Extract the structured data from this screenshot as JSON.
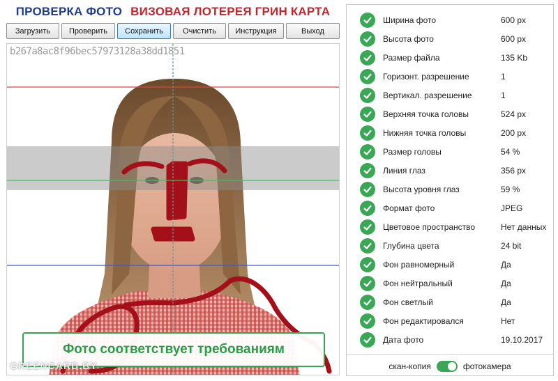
{
  "header": {
    "title_left": "ПРОВЕРКА ФОТО",
    "title_right": "ВИЗОВАЯ ЛОТЕРЕЯ ГРИН КАРТА"
  },
  "toolbar": {
    "load": "Загрузить",
    "check": "Проверить",
    "save": "Сохранить",
    "clear": "Очистить",
    "instruction": "Инструкция",
    "exit": "Выход"
  },
  "photo": {
    "hash": "b267a8ac8f96bec57973128a38dd1851",
    "status": "Фото соответствует требованиям",
    "watermark": "GREENCARD.BY"
  },
  "params": [
    {
      "label": "Ширина фото",
      "value": "600 px"
    },
    {
      "label": "Высота фото",
      "value": "600 px"
    },
    {
      "label": "Размер файла",
      "value": "135 Kb"
    },
    {
      "label": "Горизонт. разрешение",
      "value": "1"
    },
    {
      "label": "Вертикал. разрешение",
      "value": "1"
    },
    {
      "label": "Верхняя точка головы",
      "value": "524 px"
    },
    {
      "label": "Нижняя точка головы",
      "value": "200 px"
    },
    {
      "label": "Размер головы",
      "value": "54 %"
    },
    {
      "label": "Линия глаз",
      "value": "356 px"
    },
    {
      "label": "Высота уровня глаз",
      "value": "59 %"
    },
    {
      "label": "Формат фото",
      "value": "JPEG"
    },
    {
      "label": "Цветовое пространство",
      "value": "Нет данных"
    },
    {
      "label": "Глубина цвета",
      "value": "24 bit"
    },
    {
      "label": "Фон равномерный",
      "value": "Да"
    },
    {
      "label": "Фон нейтральный",
      "value": "Да"
    },
    {
      "label": "Фон светлый",
      "value": "Да"
    },
    {
      "label": "Фон редактировался",
      "value": "Нет"
    },
    {
      "label": "Дата фото",
      "value": "19.10.2017"
    }
  ],
  "mode": {
    "left_label": "скан-копия",
    "right_label": "фотокамера",
    "toggle_on": true
  },
  "colors": {
    "accent_green": "#3aa757",
    "title_blue": "#1f3d8f",
    "title_red": "#c0272d"
  }
}
